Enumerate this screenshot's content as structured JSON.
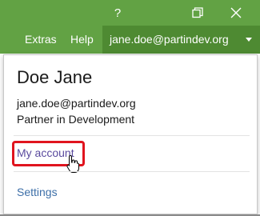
{
  "window": {
    "help_glyph": "?",
    "restore_glyph": "❐",
    "close_glyph": "✕",
    "accent_color": "#62a244"
  },
  "menubar": {
    "extras_label": "Extras",
    "help_label": "Help",
    "account_label": "jane.doe@partindev.org"
  },
  "account_menu": {
    "display_name": "Doe Jane",
    "email": "jane.doe@partindev.org",
    "role": "Partner in Development",
    "my_account_label": "My account",
    "settings_label": "Settings",
    "highlight_color": "#e0141e"
  }
}
